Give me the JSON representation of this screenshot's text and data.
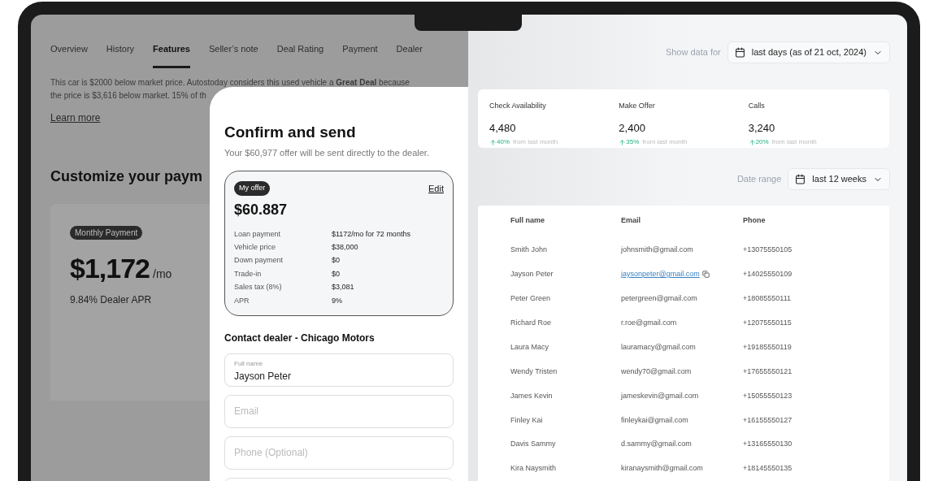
{
  "listing": {
    "tabs": [
      {
        "label": "Overview",
        "selected": false
      },
      {
        "label": "History",
        "selected": false
      },
      {
        "label": "Features",
        "selected": true
      },
      {
        "label": "Seller’s note",
        "selected": false
      },
      {
        "label": "Deal Rating",
        "selected": false
      },
      {
        "label": "Payment",
        "selected": false
      },
      {
        "label": "Dealer",
        "selected": false
      }
    ],
    "paragraph": [
      "This car is $2000 below market price. Autostoday considers this used vehicle a **Great Deal** because",
      "the price is $3,616 below market. 15% of th"
    ],
    "learn_more": "Learn more",
    "heading": "Customize your paym",
    "payment_card": {
      "badge": "Monthly Payment",
      "amount": "$1,172",
      "unit": "/mo",
      "apr": "9.84% Dealer APR"
    }
  },
  "modal": {
    "title": "Confirm and send",
    "subtitle": "Your $60,977 offer will be sent directly to the dealer.",
    "offer": {
      "badge": "My offer",
      "edit": "Edit",
      "amount": "$60.887",
      "rows": [
        {
          "label": "Loan payment",
          "value": "$1172/mo for 72 months"
        },
        {
          "label": "Vehicle price",
          "value": "$38,000"
        },
        {
          "label": "Down payment",
          "value": "$0"
        },
        {
          "label": "Trade-in",
          "value": "$0"
        },
        {
          "label": "Sales tax (8%)",
          "value": "$3,081"
        },
        {
          "label": "APR",
          "value": "9%"
        }
      ]
    },
    "contact_heading": "Contact dealer - Chicago Motors",
    "fields": [
      {
        "label": "Full name",
        "value": "Jayson Peter"
      },
      {
        "placeholder": "Email"
      },
      {
        "placeholder": "Phone (Optional)"
      }
    ]
  },
  "dashboard": {
    "show_data": {
      "label": "Show data for",
      "value": "last days (as of 21 oct, 2024)"
    },
    "stats": [
      {
        "label": "Check Availability",
        "value": "4,480",
        "change": "40%",
        "note": "from last month"
      },
      {
        "label": "Make Offer",
        "value": "2,400",
        "change": "35%",
        "note": "from last month"
      },
      {
        "label": "Calls",
        "value": "3,240",
        "change": "20%",
        "note": "from last month"
      }
    ],
    "date_range": {
      "label": "Date range",
      "value": "last 12 weeks"
    },
    "table": {
      "columns": [
        "Full name",
        "Email",
        "Phone"
      ],
      "rows": [
        {
          "name": "Smith John",
          "email": "johnsmith@gmail.com",
          "phone": "+13075550105",
          "link": false
        },
        {
          "name": "Jayson Peter",
          "email": "jaysonpeter@gmail.com",
          "phone": "+14025550109",
          "link": true
        },
        {
          "name": "Peter Green",
          "email": "petergreen@gmail.com",
          "phone": "+18085550111",
          "link": false
        },
        {
          "name": "Richard Roe",
          "email": "r.roe@gmail.com",
          "phone": "+12075550115",
          "link": false
        },
        {
          "name": "Laura Macy",
          "email": "lauramacy@gmail.com",
          "phone": "+19185550119",
          "link": false
        },
        {
          "name": "Wendy Tristen",
          "email": "wendy70@gmail.com",
          "phone": "+17655550121",
          "link": false
        },
        {
          "name": "James Kevin",
          "email": "jameskevin@gmail.com",
          "phone": "+15055550123",
          "link": false
        },
        {
          "name": "Finley Kai",
          "email": "finleykai@gmail.com",
          "phone": "+16155550127",
          "link": false
        },
        {
          "name": "Davis Sammy",
          "email": "d.sammy@gmail.com",
          "phone": "+13165550130",
          "link": false
        },
        {
          "name": "Kira Naysmith",
          "email": "kiranaysmith@gmail.com",
          "phone": "+18145550135",
          "link": false
        }
      ]
    }
  }
}
